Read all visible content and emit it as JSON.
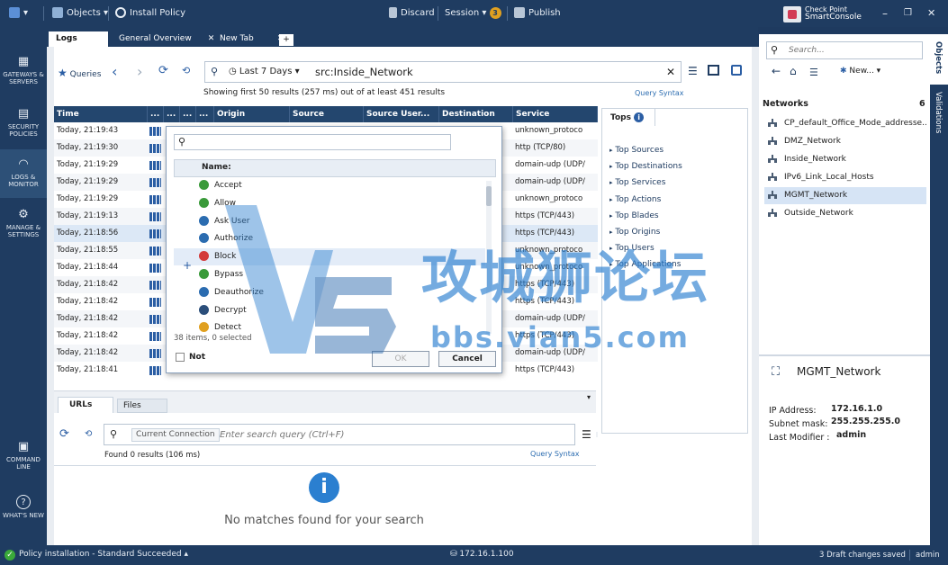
{
  "titlebar": {
    "objects": "Objects",
    "install_policy": "Install Policy",
    "discard": "Discard",
    "session": "Session",
    "session_badge": "3",
    "publish": "Publish",
    "brand_line1": "Check Point",
    "brand_line2": "SmartConsole"
  },
  "sidebar": [
    {
      "label": "GATEWAYS & SERVERS"
    },
    {
      "label": "SECURITY POLICIES"
    },
    {
      "label": "LOGS & MONITOR"
    },
    {
      "label": "MANAGE & SETTINGS"
    },
    {
      "label": "COMMAND LINE"
    },
    {
      "label": "WHAT'S NEW"
    }
  ],
  "tabs": [
    {
      "label": "Logs"
    },
    {
      "label": "General Overview"
    },
    {
      "label": "New Tab"
    }
  ],
  "toolbar": {
    "queries": "Queries",
    "time_range": "Last 7 Days",
    "query": "src:Inside_Network",
    "summary": "Showing first 50 results (257 ms) out of at least 451 results",
    "query_syntax": "Query Syntax"
  },
  "grid": {
    "columns": [
      "Time",
      "...",
      "...",
      "...",
      "...",
      "Origin",
      "Source",
      "Source User...",
      "Destination",
      "Service"
    ],
    "rows": [
      {
        "time": "Today, 21:19:43",
        "service": "unknown_protoco"
      },
      {
        "time": "Today, 21:19:30",
        "service": "http (TCP/80)"
      },
      {
        "time": "Today, 21:19:29",
        "service": "domain-udp (UDP/"
      },
      {
        "time": "Today, 21:19:29",
        "service": "domain-udp (UDP/"
      },
      {
        "time": "Today, 21:19:29",
        "service": "unknown_protoco"
      },
      {
        "time": "Today, 21:19:13",
        "service": "https (TCP/443)"
      },
      {
        "time": "Today, 21:18:56",
        "service": "https (TCP/443)"
      },
      {
        "time": "Today, 21:18:55",
        "service": "unknown_protoco"
      },
      {
        "time": "Today, 21:18:44",
        "service": "unknown_protoco"
      },
      {
        "time": "Today, 21:18:42",
        "service": "https (TCP/443)"
      },
      {
        "time": "Today, 21:18:42",
        "service": "https (TCP/443)"
      },
      {
        "time": "Today, 21:18:42",
        "service": "domain-udp (UDP/"
      },
      {
        "time": "Today, 21:18:42",
        "service": "https (TCP/443)"
      },
      {
        "time": "Today, 21:18:42",
        "service": "domain-udp (UDP/"
      },
      {
        "time": "Today, 21:18:41",
        "service": "https (TCP/443)"
      }
    ]
  },
  "popup": {
    "header": "Name:",
    "items": [
      {
        "label": "Accept",
        "color": "#3a9a3a"
      },
      {
        "label": "Allow",
        "color": "#3a9a3a"
      },
      {
        "label": "Ask User",
        "color": "#2b6cb0"
      },
      {
        "label": "Authorize",
        "color": "#2b6cb0"
      },
      {
        "label": "Block",
        "color": "#d33a3a"
      },
      {
        "label": "Bypass",
        "color": "#3a9a3a"
      },
      {
        "label": "Deauthorize",
        "color": "#2b6cb0"
      },
      {
        "label": "Decrypt",
        "color": "#2b4e7a"
      },
      {
        "label": "Detect",
        "color": "#e0a020"
      }
    ],
    "count": "38 items, 0 selected",
    "not": "Not",
    "ok": "OK",
    "cancel": "Cancel"
  },
  "tops": {
    "title": "Tops",
    "items": [
      "Top Sources",
      "Top Destinations",
      "Top Services",
      "Top Actions",
      "Top Blades",
      "Top Origins",
      "Top Users",
      "Top Applications"
    ]
  },
  "bottom": {
    "tabs": [
      "URLs",
      "Files"
    ],
    "current_connection": "Current Connection",
    "placeholder": "Enter search query (Ctrl+F)",
    "found": "Found 0 results (106 ms)",
    "query_syntax": "Query Syntax",
    "empty": "No matches found for your search"
  },
  "right": {
    "search_placeholder": "Search...",
    "new": "New...",
    "networks_title": "Networks",
    "networks_count": "6",
    "networks": [
      "CP_default_Office_Mode_addresse...",
      "DMZ_Network",
      "Inside_Network",
      "IPv6_Link_Local_Hosts",
      "MGMT_Network",
      "Outside_Network"
    ],
    "detail_title": "MGMT_Network",
    "ip_label": "IP Address:",
    "ip_value": "172.16.1.0",
    "mask_label": "Subnet mask:",
    "mask_value": "255.255.255.0",
    "modifier_label": "Last Modifier :",
    "modifier_value": "admin",
    "strip_objects": "Objects",
    "strip_validations": "Validations"
  },
  "status": {
    "left": "Policy installation - Standard Succeeded",
    "server": "172.16.1.100",
    "drafts": "3 Draft changes saved",
    "user": "admin"
  },
  "watermark": {
    "text1": "攻城狮论坛",
    "text2": "bbs.vian5.com"
  },
  "colors": {
    "navy": "#1f3c61",
    "accent": "#2b6cb0"
  }
}
